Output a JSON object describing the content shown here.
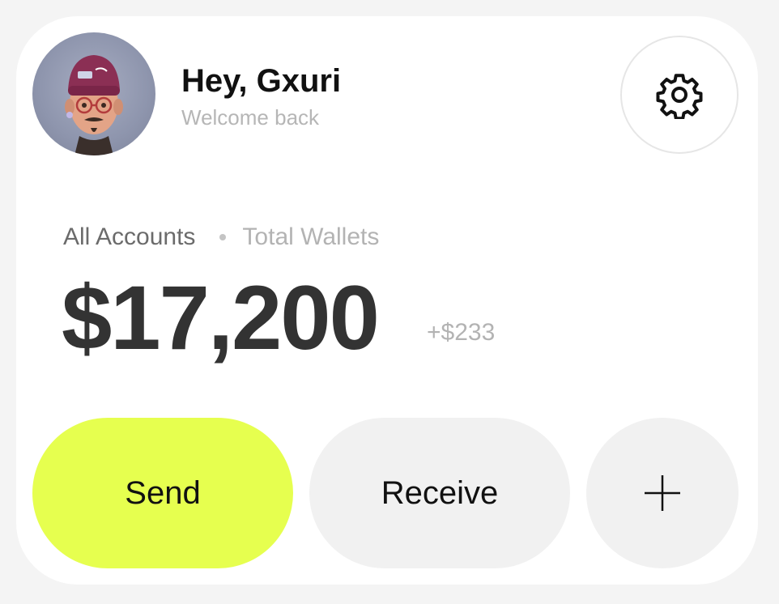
{
  "header": {
    "greeting": "Hey, Gxuri",
    "subtitle": "Welcome back",
    "avatar_icon": "avatar-image",
    "settings_icon": "gear-icon"
  },
  "accounts": {
    "tabs": [
      "All Accounts",
      "Total Wallets"
    ],
    "balance": "$17,200",
    "change": "+$233"
  },
  "actions": {
    "send_label": "Send",
    "receive_label": "Receive",
    "add_icon": "plus-icon"
  },
  "colors": {
    "accent": "#e6ff4f",
    "button_bg": "#f1f1f1",
    "text_primary": "#111111",
    "text_muted": "#b3b3b3"
  }
}
